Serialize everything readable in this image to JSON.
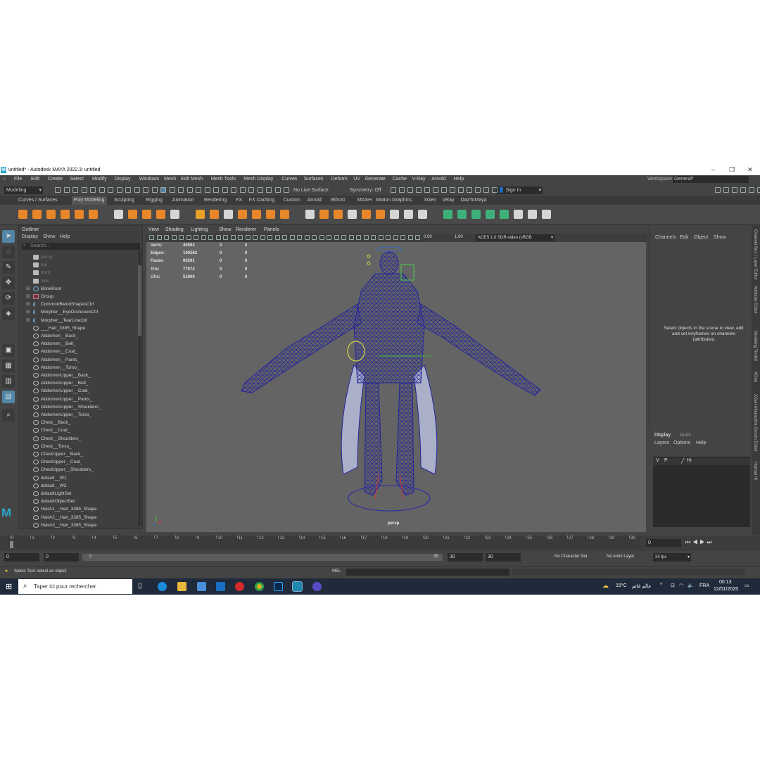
{
  "window": {
    "title": "untitled* - Autodesk MAYA 2022.3: untitled",
    "logo": "M",
    "controls": [
      "–",
      "❐",
      "✕"
    ]
  },
  "menubar": {
    "items": [
      "File",
      "Edit",
      "Create",
      "Select",
      "Modify",
      "Display",
      "Windows",
      "Mesh",
      "Edit Mesh",
      "Mesh Tools",
      "Mesh Display",
      "Curves",
      "Surfaces",
      "Deform",
      "UV",
      "Generate",
      "Cache",
      "V-Ray",
      "Arnold",
      "Help"
    ],
    "workspace_label": "Workspace:",
    "workspace_value": "General*"
  },
  "statusline": {
    "mode": "Modeling",
    "live_surface": "No Live Surface",
    "symmetry": "Symmetry: Off",
    "sign_in": "Sign In"
  },
  "shelf": {
    "tabs": [
      "Curves / Surfaces",
      "Poly Modeling",
      "Sculpting",
      "Rigging",
      "Animation",
      "Rendering",
      "FX",
      "FX Caching",
      "Custom",
      "Arnold",
      "Bifrost",
      "MASH",
      "Motion Graphics",
      "XGen",
      "VRay",
      "DazToMaya"
    ],
    "active_tab": "Poly Modeling"
  },
  "outliner": {
    "title": "Outliner",
    "menus": [
      "Display",
      "Show",
      "Help"
    ],
    "search_placeholder": "Search...",
    "items": [
      {
        "label": "persp",
        "dim": true,
        "expand": false,
        "icon": "camera-icon"
      },
      {
        "label": "top",
        "dim": true,
        "expand": false,
        "icon": "camera-icon"
      },
      {
        "label": "front",
        "dim": true,
        "expand": false,
        "icon": "camera-icon"
      },
      {
        "label": "side",
        "dim": true,
        "expand": false,
        "icon": "camera-icon"
      },
      {
        "label": "BoneRoot",
        "dim": false,
        "expand": true,
        "icon": "joint-icon"
      },
      {
        "label": "Group",
        "dim": false,
        "expand": true,
        "icon": "group-icon"
      },
      {
        "label": "CommonBlendShapesCtrl",
        "dim": false,
        "expand": true,
        "icon": "curve-icon"
      },
      {
        "label": "Morpher__EyeOcclusionCtrl",
        "dim": false,
        "expand": true,
        "icon": "curve-icon"
      },
      {
        "label": "Morpher__TearLineCtrl",
        "dim": false,
        "expand": true,
        "icon": "curve-icon"
      },
      {
        "label": "___Hair_3385_Shape",
        "dim": false,
        "expand": false,
        "icon": "set-icon"
      },
      {
        "label": "Abdomen__Back_",
        "dim": false,
        "expand": false,
        "icon": "set-icon"
      },
      {
        "label": "Abdomen__Belt_",
        "dim": false,
        "expand": false,
        "icon": "set-icon"
      },
      {
        "label": "Abdomen__Coat_",
        "dim": false,
        "expand": false,
        "icon": "set-icon"
      },
      {
        "label": "Abdomen__Pants_",
        "dim": false,
        "expand": false,
        "icon": "set-icon"
      },
      {
        "label": "Abdomen__Torso_",
        "dim": false,
        "expand": false,
        "icon": "set-icon"
      },
      {
        "label": "AbdomenUpper__Back_",
        "dim": false,
        "expand": false,
        "icon": "set-icon"
      },
      {
        "label": "AbdomenUpper__Belt_",
        "dim": false,
        "expand": false,
        "icon": "set-icon"
      },
      {
        "label": "AbdomenUpper__Coat_",
        "dim": false,
        "expand": false,
        "icon": "set-icon"
      },
      {
        "label": "AbdomenUpper__Pants_",
        "dim": false,
        "expand": false,
        "icon": "set-icon"
      },
      {
        "label": "AbdomenUpper__Shoulders_",
        "dim": false,
        "expand": false,
        "icon": "set-icon"
      },
      {
        "label": "AbdomenUpper__Torso_",
        "dim": false,
        "expand": false,
        "icon": "set-icon"
      },
      {
        "label": "Chest__Back_",
        "dim": false,
        "expand": false,
        "icon": "set-icon"
      },
      {
        "label": "Chest__Coat_",
        "dim": false,
        "expand": false,
        "icon": "set-icon"
      },
      {
        "label": "Chest__Shoulders_",
        "dim": false,
        "expand": false,
        "icon": "set-icon"
      },
      {
        "label": "Chest__Torso_",
        "dim": false,
        "expand": false,
        "icon": "set-icon"
      },
      {
        "label": "ChestUpper__Back_",
        "dim": false,
        "expand": false,
        "icon": "set-icon"
      },
      {
        "label": "ChestUpper__Coat_",
        "dim": false,
        "expand": false,
        "icon": "set-icon"
      },
      {
        "label": "ChestUpper__Shoulders_",
        "dim": false,
        "expand": false,
        "icon": "set-icon"
      },
      {
        "label": "default__W1",
        "dim": false,
        "expand": false,
        "icon": "set-icon"
      },
      {
        "label": "default__W2",
        "dim": false,
        "expand": false,
        "icon": "set-icon"
      },
      {
        "label": "defaultLightSet",
        "dim": false,
        "expand": false,
        "icon": "set-icon"
      },
      {
        "label": "defaultObjectSet",
        "dim": false,
        "expand": false,
        "icon": "set-icon"
      },
      {
        "label": "HairA1__Hair_3385_Shape",
        "dim": false,
        "expand": false,
        "icon": "set-icon"
      },
      {
        "label": "HairA2__Hair_3385_Shape",
        "dim": false,
        "expand": false,
        "icon": "set-icon"
      },
      {
        "label": "HairA3__Hair_3385_Shape",
        "dim": false,
        "expand": false,
        "icon": "set-icon"
      }
    ]
  },
  "viewport": {
    "menus": [
      "View",
      "Shading",
      "Lighting",
      "Show",
      "Renderer",
      "Panels"
    ],
    "exposure": "0.00",
    "gamma": "1.00",
    "color_space": "ACES 1.0 SDR-video (sRGB",
    "camera": "persp",
    "hud": [
      {
        "label": "Verts:",
        "a": "40093",
        "b": "0",
        "c": "0"
      },
      {
        "label": "Edges:",
        "a": "100262",
        "b": "0",
        "c": "0"
      },
      {
        "label": "Faces:",
        "a": "60291",
        "b": "0",
        "c": "0"
      },
      {
        "label": "Tris:",
        "a": "77974",
        "b": "0",
        "c": "0"
      },
      {
        "label": "UVs:",
        "a": "51900",
        "b": "0",
        "c": "0"
      }
    ],
    "wire_color": "#2a2aa8"
  },
  "channelbox": {
    "menus": [
      "Channels",
      "Edit",
      "Object",
      "Show"
    ],
    "message": "Select objects in the scene to view, edit and set keyframes on channels (attributes)"
  },
  "side_tabs": [
    "Channel Box / Layer Editor",
    "Attribute Editor",
    "Modeling Toolkit",
    "XGen",
    "XGen Interactive Groom Editor",
    "Human IK"
  ],
  "layers": {
    "tabs": [
      "Display",
      "Anim"
    ],
    "menus": [
      "Layers",
      "Options",
      "Help"
    ],
    "row": {
      "v": "V",
      "p": "P",
      "name": "Hi"
    }
  },
  "timeline": {
    "ticks": [
      "0",
      "1",
      "2",
      "3",
      "4",
      "5",
      "6",
      "7",
      "8",
      "9",
      "10",
      "11",
      "12",
      "13",
      "14",
      "15",
      "16",
      "17",
      "18",
      "19",
      "20",
      "21",
      "22",
      "23",
      "24",
      "25",
      "26",
      "27",
      "28",
      "29",
      "30"
    ],
    "current_frame": "0",
    "start": "0",
    "range_start": "0",
    "range_inner_start": "0",
    "range_inner_end": "30",
    "range_end": "30",
    "end": "30",
    "character_set": "No Character Set",
    "anim_layer": "No Anim Layer",
    "fps": "24 fps"
  },
  "commandline": {
    "help": "Select Tool: select an object",
    "mel": "MEL"
  },
  "taskbar": {
    "search": "Taper ici pour rechercher",
    "weather": "15°C",
    "weather_text": "عالم غائم",
    "lang": "FRA",
    "time": "00:13",
    "date": "12/01/2025"
  }
}
